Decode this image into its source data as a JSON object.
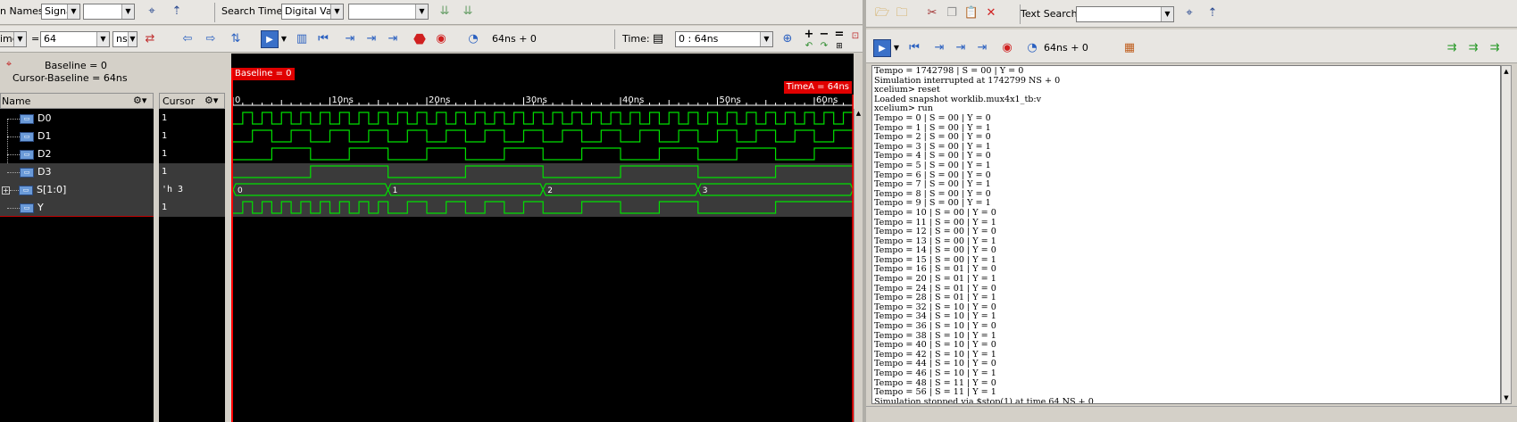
{
  "left_toolbar1": {
    "names_label": "n Names:",
    "names_type": "Signal",
    "names_value": "",
    "search_times_label": "Search Times:",
    "search_times_type": "Digital Value",
    "search_times_value": ""
  },
  "left_toolbar2": {
    "marker_name": "imeA",
    "equals": "=",
    "marker_value": "64",
    "time_unit": "ns",
    "time_display": "64ns + 0",
    "time_label": "Time:",
    "time_range": "0 : 64ns"
  },
  "waveform": {
    "baseline_info": "Baseline = 0",
    "cursor_baseline_info": "Cursor-Baseline = 64ns",
    "name_header": "Name",
    "cursor_header": "Cursor",
    "baseline_flag": "Baseline = 0",
    "timea_flag": "TimeA = 64ns",
    "ruler_labels": [
      "0",
      "10ns",
      "20ns",
      "30ns",
      "40ns",
      "50ns",
      "60ns"
    ],
    "signals": [
      {
        "name": "D0",
        "value": "1"
      },
      {
        "name": "D1",
        "value": "1"
      },
      {
        "name": "D2",
        "value": "1"
      },
      {
        "name": "D3",
        "value": "1"
      },
      {
        "name": "S[1:0]",
        "value": "'h 3"
      },
      {
        "name": "Y",
        "value": "1"
      }
    ],
    "bus_labels": [
      "0",
      "1",
      "2",
      "3"
    ],
    "wave_color": "#00e000",
    "cursor_color": "#ff0000"
  },
  "right_toolbar1": {
    "text_search_label": "Text Search:",
    "text_search_value": ""
  },
  "right_toolbar2": {
    "time_display": "64ns + 0"
  },
  "console": {
    "lines": [
      "Tempo = 1742798 | S = 00 | Y = 0",
      "Simulation interrupted at 1742799 NS + 0",
      "xcelium> reset",
      "Loaded snapshot worklib.mux4x1_tb:v",
      "xcelium> run",
      "Tempo = 0 | S = 00 | Y = 0",
      "Tempo = 1 | S = 00 | Y = 1",
      "Tempo = 2 | S = 00 | Y = 0",
      "Tempo = 3 | S = 00 | Y = 1",
      "Tempo = 4 | S = 00 | Y = 0",
      "Tempo = 5 | S = 00 | Y = 1",
      "Tempo = 6 | S = 00 | Y = 0",
      "Tempo = 7 | S = 00 | Y = 1",
      "Tempo = 8 | S = 00 | Y = 0",
      "Tempo = 9 | S = 00 | Y = 1",
      "Tempo = 10 | S = 00 | Y = 0",
      "Tempo = 11 | S = 00 | Y = 1",
      "Tempo = 12 | S = 00 | Y = 0",
      "Tempo = 13 | S = 00 | Y = 1",
      "Tempo = 14 | S = 00 | Y = 0",
      "Tempo = 15 | S = 00 | Y = 1",
      "Tempo = 16 | S = 01 | Y = 0",
      "Tempo = 20 | S = 01 | Y = 1",
      "Tempo = 24 | S = 01 | Y = 0",
      "Tempo = 28 | S = 01 | Y = 1",
      "Tempo = 32 | S = 10 | Y = 0",
      "Tempo = 34 | S = 10 | Y = 1",
      "Tempo = 36 | S = 10 | Y = 0",
      "Tempo = 38 | S = 10 | Y = 1",
      "Tempo = 40 | S = 10 | Y = 0",
      "Tempo = 42 | S = 10 | Y = 1",
      "Tempo = 44 | S = 10 | Y = 0",
      "Tempo = 46 | S = 10 | Y = 1",
      "Tempo = 48 | S = 11 | Y = 0",
      "Tempo = 56 | S = 11 | Y = 1",
      "Simulation stopped via $stop(1) at time 64 NS + 0",
      "xcelium> "
    ]
  }
}
